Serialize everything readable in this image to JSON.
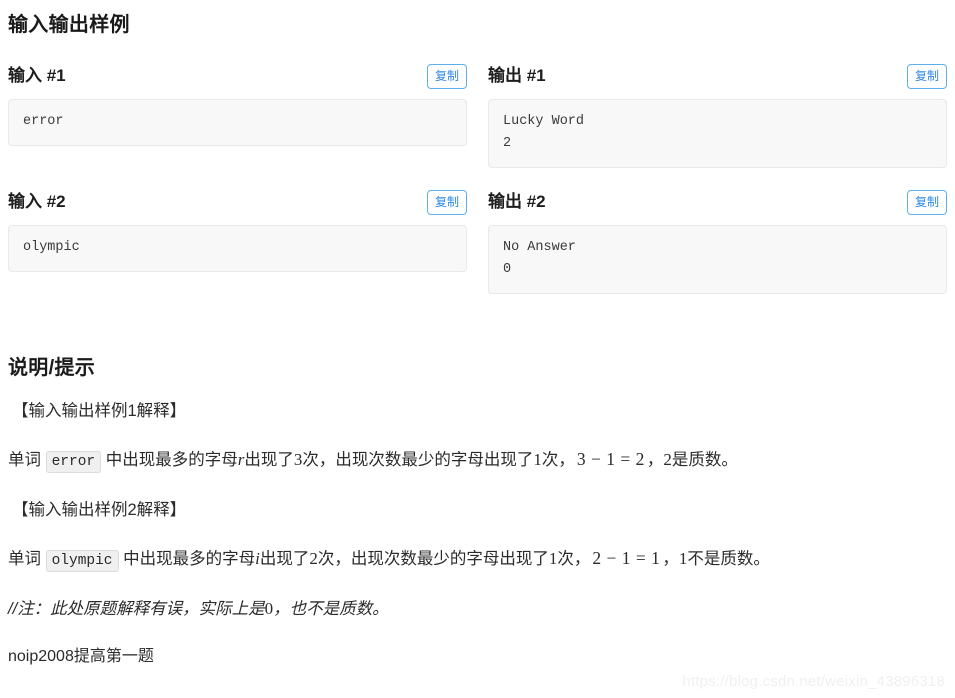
{
  "sections": {
    "io_title": "输入输出样例",
    "hint_title": "说明/提示"
  },
  "copy_label": "复制",
  "samples": [
    {
      "input": {
        "label": "输入 #1",
        "content": "error"
      },
      "output": {
        "label": "输出 #1",
        "content": "Lucky Word\n2"
      }
    },
    {
      "input": {
        "label": "输入 #2",
        "content": "olympic"
      },
      "output": {
        "label": "输出 #2",
        "content": "No Answer\n0"
      }
    }
  ],
  "hint": {
    "bracket1": "【输入输出样例1解释】",
    "explain1": {
      "prefix": "单词 ",
      "code": "error",
      "mid1": " 中出现最多的字母",
      "letter": "r",
      "mid2": "出现了",
      "count": "3",
      "mid3": "次，出现次数最少的字母出现了",
      "min_count": "1",
      "mid4": "次，",
      "equation": "3 − 1 = 2",
      "comma": "，",
      "result_num": "2",
      "suffix": "是质数。"
    },
    "bracket2": "【输入输出样例2解释】",
    "explain2": {
      "prefix": "单词 ",
      "code": "olympic",
      "mid1": " 中出现最多的字母",
      "letter": "i",
      "mid2": "出现了",
      "count": "2",
      "mid3": "次，出现次数最少的字母出现了",
      "min_count": "1",
      "mid4": "次，",
      "equation": "2 − 1 = 1",
      "comma": "，",
      "result_num": "1",
      "suffix": "不是质数。"
    },
    "note": {
      "prefix": "//注：此处原题解释有误，实际上是",
      "value": "0",
      "suffix": "，也不是质数。"
    },
    "tail": "noip2008提高第一题"
  },
  "watermark": "https://blog.csdn.net/weixin_43896318",
  "colors": {
    "accent": "#2e8ae6",
    "code_bg": "#f8f8f8",
    "text": "#2b2b2b"
  }
}
